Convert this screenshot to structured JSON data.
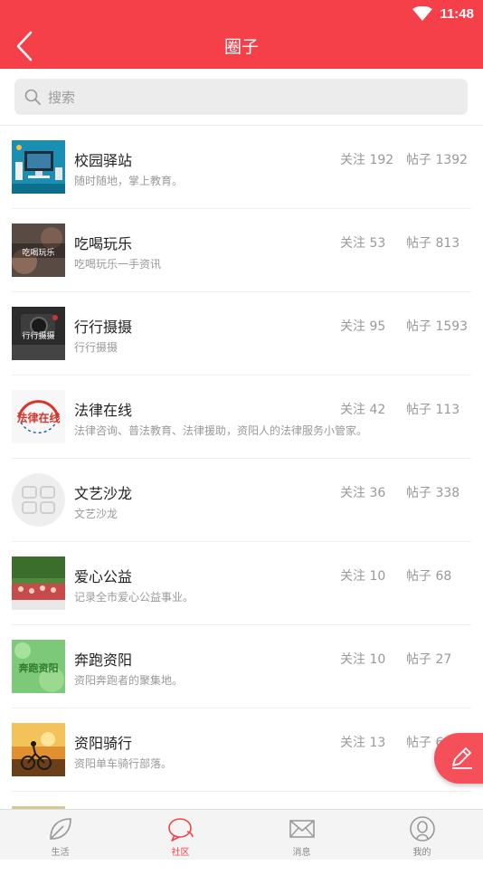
{
  "status": {
    "time": "11:48",
    "wifi_icon": "wifi-icon"
  },
  "header": {
    "title": "圈子",
    "back_icon": "back-arrow-icon"
  },
  "search": {
    "placeholder": "搜索",
    "icon": "search-icon"
  },
  "circles": [
    {
      "name": "校园驿站",
      "desc": "随时随地，掌上教育。",
      "follow": "关注 192",
      "posts": "帖子 1392"
    },
    {
      "name": "吃喝玩乐",
      "desc": "吃喝玩乐一手资讯",
      "follow": "关注 53",
      "posts": "帖子 813",
      "thumb_text": "吃喝玩乐"
    },
    {
      "name": "行行摄摄",
      "desc": "行行摄摄",
      "follow": "关注 95",
      "posts": "帖子 1593",
      "thumb_text": "行行摄摄"
    },
    {
      "name": "法律在线",
      "desc": "法律咨询、普法教育、法律援助，资阳人的法律服务小管家。",
      "follow": "关注 42",
      "posts": "帖子 113",
      "thumb_text": "法律在线"
    },
    {
      "name": "文艺沙龙",
      "desc": "文艺沙龙",
      "follow": "关注 36",
      "posts": "帖子 338"
    },
    {
      "name": "爱心公益",
      "desc": "记录全市爱心公益事业。",
      "follow": "关注 10",
      "posts": "帖子 68"
    },
    {
      "name": "奔跑资阳",
      "desc": "资阳奔跑者的聚集地。",
      "follow": "关注 10",
      "posts": "帖子 27",
      "thumb_text": "奔跑资阳"
    },
    {
      "name": "资阳骑行",
      "desc": "资阳单车骑行部落。",
      "follow": "关注 13",
      "posts": "帖子 6"
    }
  ],
  "fab": {
    "icon": "edit-pencil-icon"
  },
  "tabs": [
    {
      "label": "生活",
      "icon": "leaf-icon"
    },
    {
      "label": "社区",
      "icon": "chat-bubble-icon",
      "active": true
    },
    {
      "label": "消息",
      "icon": "envelope-icon"
    },
    {
      "label": "我的",
      "icon": "user-icon"
    }
  ],
  "colors": {
    "brand": "#f5404a",
    "fab": "#f5505a",
    "text": "#222222",
    "muted": "#999999"
  }
}
